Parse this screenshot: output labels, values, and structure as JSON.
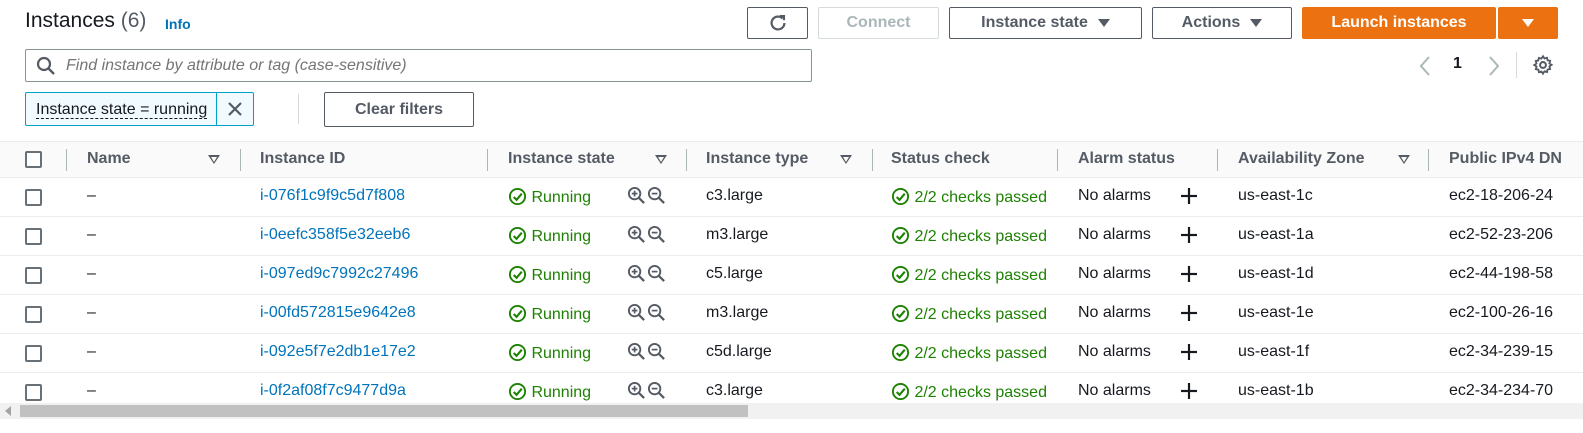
{
  "header": {
    "title": "Instances",
    "count": "(6)",
    "info": "Info",
    "connect_label": "Connect",
    "instance_state_label": "Instance state",
    "actions_label": "Actions",
    "launch_label": "Launch instances"
  },
  "search": {
    "placeholder": "Find instance by attribute or tag (case-sensitive)",
    "value": ""
  },
  "pagination": {
    "page": "1"
  },
  "filter": {
    "token": "Instance state = running",
    "clear_label": "Clear filters"
  },
  "columns": [
    "Name",
    "Instance ID",
    "Instance state",
    "Instance type",
    "Status check",
    "Alarm status",
    "Availability Zone",
    "Public IPv4 DN"
  ],
  "rows": [
    {
      "name": "–",
      "id": "i-076f1c9f9c5d7f808",
      "state": "Running",
      "type": "c3.large",
      "status": "2/2 checks passed",
      "alarm": "No alarms",
      "az": "us-east-1c",
      "dns": "ec2-18-206-24"
    },
    {
      "name": "–",
      "id": "i-0eefc358f5e32eeb6",
      "state": "Running",
      "type": "m3.large",
      "status": "2/2 checks passed",
      "alarm": "No alarms",
      "az": "us-east-1a",
      "dns": "ec2-52-23-206"
    },
    {
      "name": "–",
      "id": "i-097ed9c7992c27496",
      "state": "Running",
      "type": "c5.large",
      "status": "2/2 checks passed",
      "alarm": "No alarms",
      "az": "us-east-1d",
      "dns": "ec2-44-198-58"
    },
    {
      "name": "–",
      "id": "i-00fd572815e9642e8",
      "state": "Running",
      "type": "m3.large",
      "status": "2/2 checks passed",
      "alarm": "No alarms",
      "az": "us-east-1e",
      "dns": "ec2-100-26-16"
    },
    {
      "name": "–",
      "id": "i-092e5f7e2db1e17e2",
      "state": "Running",
      "type": "c5d.large",
      "status": "2/2 checks passed",
      "alarm": "No alarms",
      "az": "us-east-1f",
      "dns": "ec2-34-239-15"
    },
    {
      "name": "–",
      "id": "i-0f2af08f7c9477d9a",
      "state": "Running",
      "type": "c3.large",
      "status": "2/2 checks passed",
      "alarm": "No alarms",
      "az": "us-east-1b",
      "dns": "ec2-34-234-70"
    }
  ],
  "colors": {
    "accent": "#ec7211",
    "link": "#0073bb",
    "success": "#1d8102"
  }
}
